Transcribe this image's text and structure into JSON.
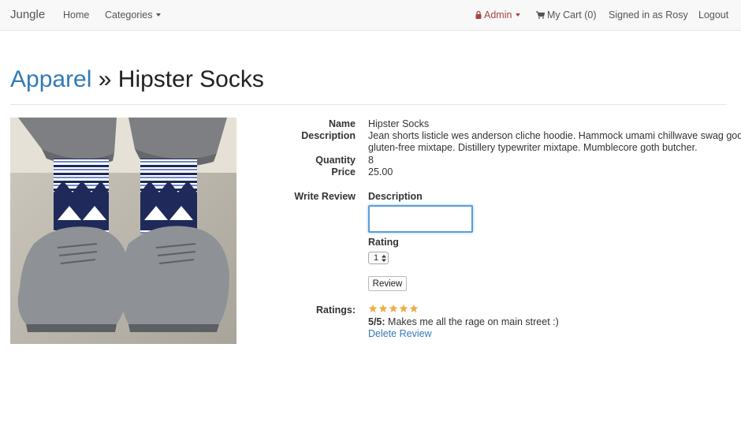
{
  "navbar": {
    "brand": "Jungle",
    "home": "Home",
    "categories": "Categories",
    "admin": "Admin",
    "cart": "My Cart (0)",
    "signed_in": "Signed in as Rosy",
    "logout": "Logout"
  },
  "heading": {
    "category": "Apparel",
    "separator": "»",
    "product": "Hipster Socks"
  },
  "details": {
    "name_label": "Name",
    "name_value": "Hipster Socks",
    "description_label": "Description",
    "description_line1": "Jean shorts listicle wes anderson cliche hoodie. Hammock umami chillwave swag godard",
    "description_line2": "gluten-free mixtape. Distillery typewriter mixtape. Mumblecore goth butcher.",
    "quantity_label": "Quantity",
    "quantity_value": "8",
    "price_label": "Price",
    "price_value": "25.00"
  },
  "review_form": {
    "section_label": "Write Review",
    "description_label": "Description",
    "description_value": "",
    "rating_label": "Rating",
    "rating_selected": "1",
    "submit_label": "Review"
  },
  "ratings": {
    "section_label": "Ratings:",
    "stars": 5,
    "max_stars": 5,
    "score": "5/5:",
    "comment": "Makes me all the rage on main street :)",
    "delete_label": "Delete Review"
  },
  "colors": {
    "link": "#337ab7",
    "admin": "#a94442",
    "star": "#f0ad4e"
  }
}
